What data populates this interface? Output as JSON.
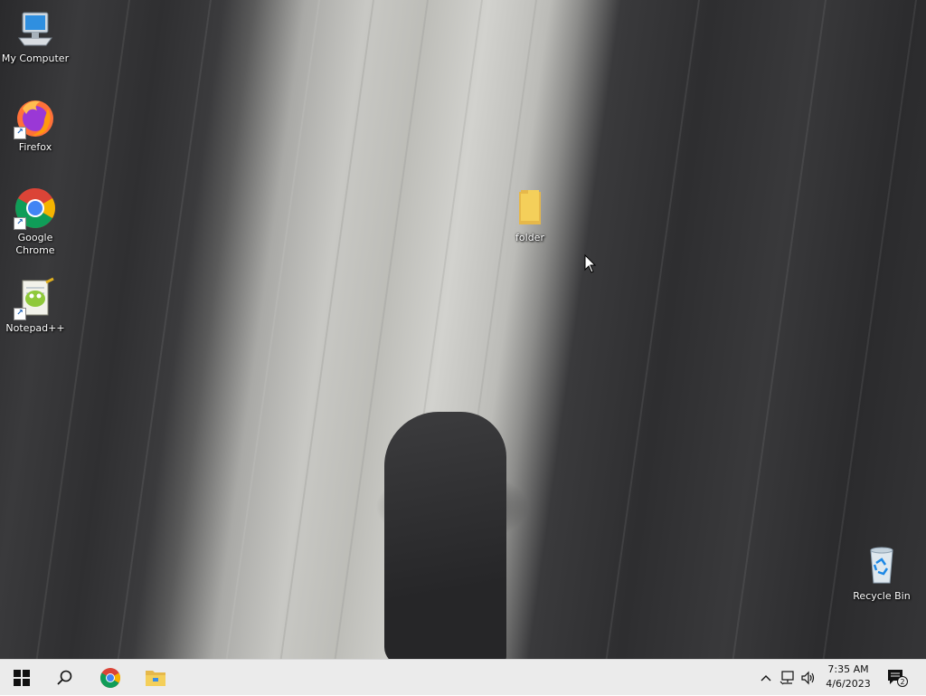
{
  "desktop": {
    "icons": [
      {
        "label": "My Computer",
        "icon": "computer-icon"
      },
      {
        "label": "Firefox",
        "icon": "firefox-icon"
      },
      {
        "label": "Google Chrome",
        "icon": "chrome-icon"
      },
      {
        "label": "Notepad++",
        "icon": "notepad-plus-plus-icon"
      },
      {
        "label": "folder",
        "icon": "folder-icon"
      },
      {
        "label": "Recycle Bin",
        "icon": "recycle-bin-icon"
      }
    ]
  },
  "taskbar": {
    "pinned": [
      {
        "name": "start",
        "icon": "windows-logo-icon"
      },
      {
        "name": "search",
        "icon": "search-icon"
      },
      {
        "name": "Google Chrome",
        "icon": "chrome-icon"
      },
      {
        "name": "File Explorer",
        "icon": "file-explorer-icon"
      }
    ],
    "tray": {
      "icons": [
        "chevron-up-icon",
        "network-icon",
        "volume-icon"
      ],
      "time": "7:35 AM",
      "date": "4/6/2023",
      "notification_count": "2"
    }
  },
  "colors": {
    "taskbar_bg": "#ebebeb",
    "folder_yellow": "#f4cf5a",
    "chrome_red": "#db4437",
    "chrome_yellow": "#f4b400",
    "chrome_green": "#0f9d58",
    "chrome_blue": "#4285f4"
  }
}
